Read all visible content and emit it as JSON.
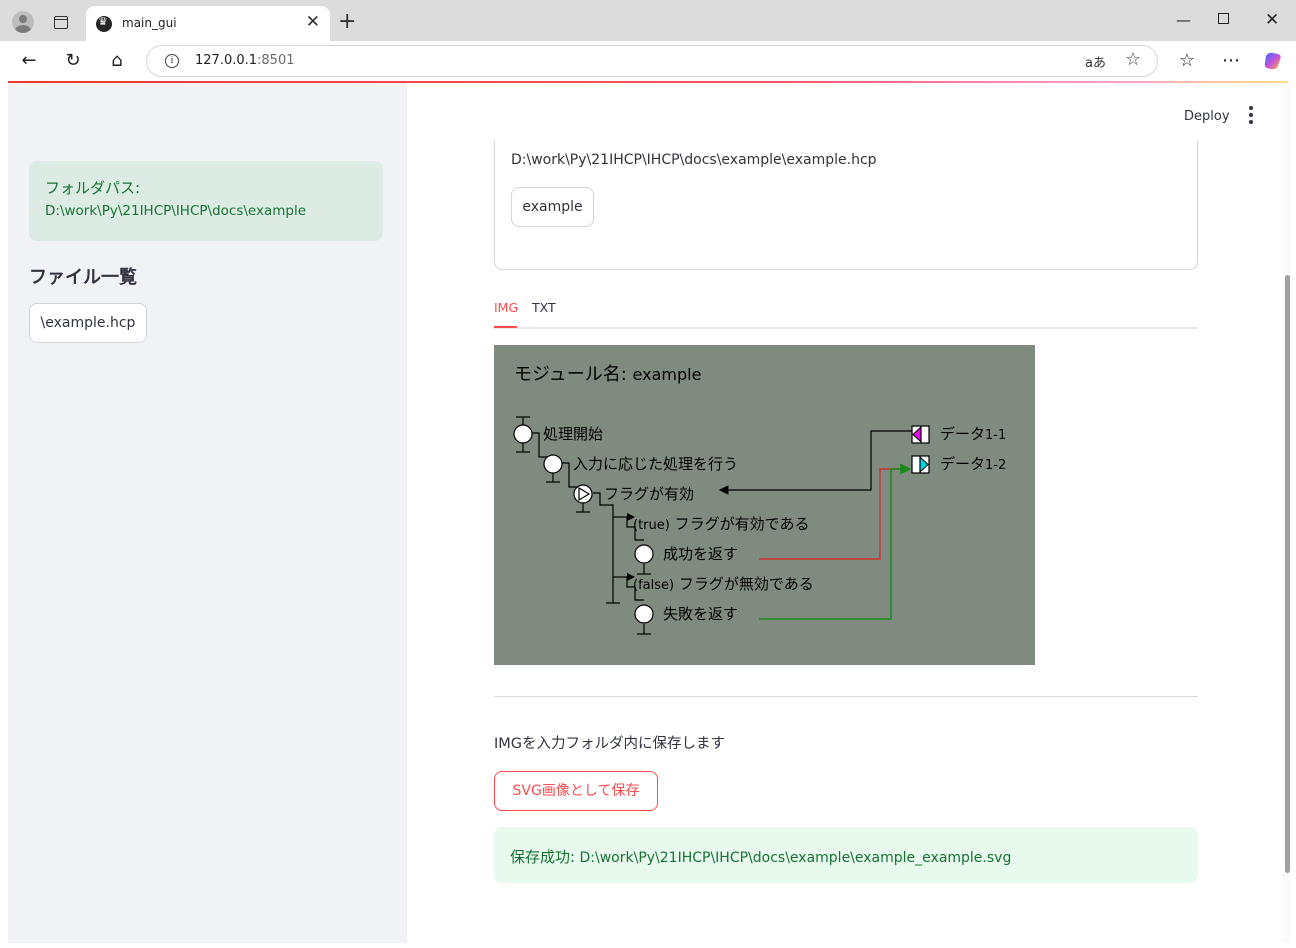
{
  "browser": {
    "tab_title": "main_gui",
    "url_host": "127.0.0.1",
    "url_port": ":8501",
    "translate_label": "aあ"
  },
  "sidebar": {
    "folder_label": "フォルダパス:",
    "folder_path": "D:\\work\\Py\\21IHCP\\IHCP\\docs\\example",
    "file_list_heading": "ファイル一覧",
    "files": [
      "\\example.hcp"
    ]
  },
  "header": {
    "deploy_label": "Deploy"
  },
  "main": {
    "file_path": "D:\\work\\Py\\21IHCP\\IHCP\\docs\\example\\example.hcp",
    "module_button": "example",
    "tabs": [
      {
        "label": "IMG",
        "active": true
      },
      {
        "label": "TXT",
        "active": false
      }
    ],
    "save_instruction": "IMGを入力フォルダ内に保存します",
    "save_button": "SVG画像として保存",
    "success_label": "保存成功:",
    "success_path": "D:\\work\\Py\\21IHCP\\IHCP\\docs\\example\\example_example.svg"
  },
  "diagram": {
    "title_prefix": "モジュール名:",
    "title_name": "example",
    "nodes": {
      "n1": "処理開始",
      "n2": "入力に応じた処理を行う",
      "n3": "フラグが有効",
      "n4_tag": "(true)",
      "n4": "フラグが有効である",
      "n5": "成功を返す",
      "n6_tag": "(false)",
      "n6": "フラグが無効である",
      "n7": "失敗を返す"
    },
    "data": {
      "d1": "データ",
      "d1_num": "1-1",
      "d2": "データ",
      "d2_num": "1-2"
    },
    "colors": {
      "background": "#808b7f",
      "data_in": "#e600e6",
      "data_out": "#00d8e0",
      "red_line": "#d03030",
      "green_line": "#1a8a1a"
    }
  },
  "theme": {
    "accent": "#ff4b4b",
    "success_text": "#177233",
    "success_bg": "#e8f9ee"
  }
}
